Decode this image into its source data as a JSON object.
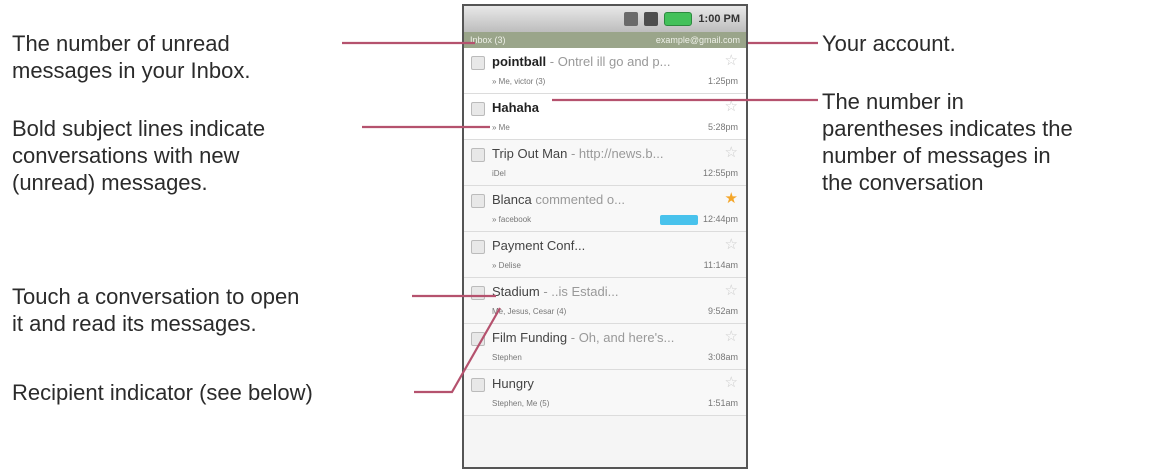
{
  "annotations": {
    "unread_count": [
      "The number of unread",
      "messages in your Inbox."
    ],
    "bold_subjects": [
      "Bold subject lines indicate",
      "conversations with new",
      "(unread) messages."
    ],
    "touch_conversation": [
      "Touch a conversation to open",
      "it and read its messages."
    ],
    "recipient_indicator": [
      "Recipient indicator (see below)"
    ],
    "your_account": [
      "Your account."
    ],
    "message_count": [
      "The number in",
      "parentheses indicates the",
      "number of messages in",
      "the conversation"
    ]
  },
  "phone": {
    "status_time": "1:00 PM",
    "inbox_label": "Inbox (3)",
    "account_label": "example@gmail.com",
    "conversations": [
      {
        "subject": "pointball",
        "snippet": " - Ontrel ill go and p...",
        "from": "» Me, victor (3)",
        "time": "1:25pm",
        "unread": true,
        "starred": false
      },
      {
        "subject": "Hahaha",
        "snippet": "",
        "from": "» Me",
        "time": "5:28pm",
        "unread": true,
        "starred": false
      },
      {
        "subject": "Trip Out Man",
        "snippet": " - http://news.b...",
        "from": "iDel",
        "time": "12:55pm",
        "unread": false,
        "starred": false
      },
      {
        "subject": "Blanca",
        "snippet": "   commented o...",
        "from": "» facebook",
        "time": "12:44pm",
        "unread": false,
        "starred": true
      },
      {
        "subject": "Payment Conf...",
        "snippet": "",
        "from": "» Delise",
        "time": "11:14am",
        "unread": false,
        "starred": false
      },
      {
        "subject": "Stadium",
        "snippet": "  - ..is Estadi...",
        "from": "Me, Jesus, Cesar (4)",
        "time": "9:52am",
        "unread": false,
        "starred": false
      },
      {
        "subject": "Film Funding",
        "snippet": " - Oh, and here's...",
        "from": "Stephen",
        "time": "3:08am",
        "unread": false,
        "starred": false
      },
      {
        "subject": "Hungry",
        "snippet": "",
        "from": "Stephen, Me (5)",
        "time": "1:51am",
        "unread": false,
        "starred": false
      }
    ]
  },
  "colors": {
    "leader_line": "#b5526e",
    "title_bar": "#9aa58a",
    "star_on": "#f4a62a",
    "label_chip": "#48c2ec"
  }
}
